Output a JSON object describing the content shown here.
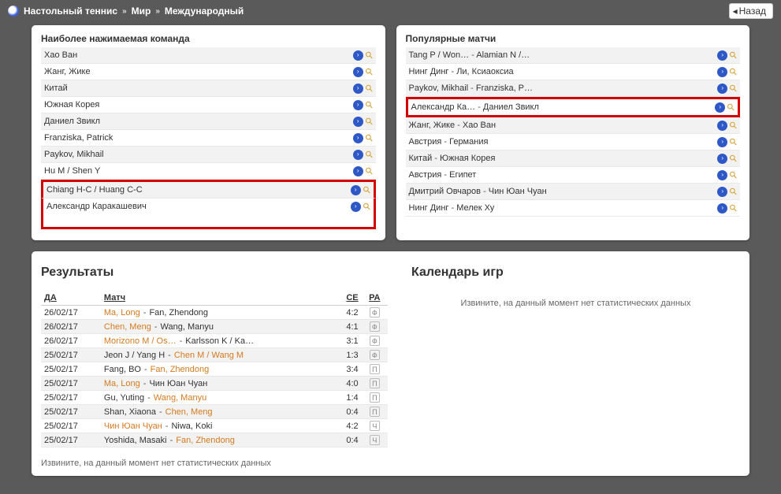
{
  "breadcrumb": {
    "sport": "Настольный теннис",
    "region": "Мир",
    "league": "Международный"
  },
  "back_label": "Назад",
  "teams_panel": {
    "title": "Наиболее нажимаемая команда",
    "items": [
      {
        "label": "Хао Ван"
      },
      {
        "label": "Жанг, Жике"
      },
      {
        "label": "Китай"
      },
      {
        "label": "Южная Корея"
      },
      {
        "label": "Даниел Звикл"
      },
      {
        "label": "Franziska, Patrick"
      },
      {
        "label": "Paykov, Mikhail"
      },
      {
        "label": "Hu M / Shen Y"
      },
      {
        "label": "Chiang H-C / Huang C-C"
      },
      {
        "label": "Александр Каракашевич"
      }
    ]
  },
  "matches_panel": {
    "title": "Популярные матчи",
    "items": [
      {
        "a": "Tang P / Won…",
        "b": "Alamian N /…"
      },
      {
        "a": "Нинг Динг",
        "b": "Ли, Ксиаоксиа"
      },
      {
        "a": "Paykov, Mikhail",
        "b": "Franziska, P…"
      },
      {
        "a": "Александр Ка…",
        "b": "Даниел Звикл"
      },
      {
        "a": "Жанг, Жике",
        "b": "Хао Ван"
      },
      {
        "a": "Австрия",
        "b": "Германия"
      },
      {
        "a": "Китай",
        "b": "Южная Корея"
      },
      {
        "a": "Австрия",
        "b": "Египет"
      },
      {
        "a": "Дмитрий Овчаров",
        "b": "Чин Юан Чуан"
      },
      {
        "a": "Нинг Динг",
        "b": "Мелек Ху"
      }
    ]
  },
  "results": {
    "title": "Результаты",
    "cols": {
      "date": "ДА",
      "match": "Матч",
      "set": "СЕ",
      "ra": "РА"
    },
    "rows": [
      {
        "date": "26/02/17",
        "a": "Ma, Long",
        "b": "Fan, Zhendong",
        "alink": true,
        "blink": false,
        "score": "4:2",
        "icon": "Ф"
      },
      {
        "date": "26/02/17",
        "a": "Chen, Meng",
        "b": "Wang, Manyu",
        "alink": true,
        "blink": false,
        "score": "4:1",
        "icon": "Ф"
      },
      {
        "date": "26/02/17",
        "a": "Morizono M / Os…",
        "b": "Karlsson K / Ka…",
        "alink": true,
        "blink": false,
        "score": "3:1",
        "icon": "Ф"
      },
      {
        "date": "25/02/17",
        "a": "Jeon J / Yang H",
        "b": "Chen M / Wang M",
        "alink": false,
        "blink": true,
        "score": "1:3",
        "icon": "Ф"
      },
      {
        "date": "25/02/17",
        "a": "Fang, BO",
        "b": "Fan, Zhendong",
        "alink": false,
        "blink": true,
        "score": "3:4",
        "icon": "П"
      },
      {
        "date": "25/02/17",
        "a": "Ma, Long",
        "b": "Чин Юан Чуан",
        "alink": true,
        "blink": false,
        "score": "4:0",
        "icon": "П"
      },
      {
        "date": "25/02/17",
        "a": "Gu, Yuting",
        "b": "Wang, Manyu",
        "alink": false,
        "blink": true,
        "score": "1:4",
        "icon": "П"
      },
      {
        "date": "25/02/17",
        "a": "Shan, Xiaona",
        "b": "Chen, Meng",
        "alink": false,
        "blink": true,
        "score": "0:4",
        "icon": "П"
      },
      {
        "date": "25/02/17",
        "a": "Чин Юан Чуан",
        "b": "Niwa, Koki",
        "alink": true,
        "blink": false,
        "score": "4:2",
        "icon": "Ч"
      },
      {
        "date": "25/02/17",
        "a": "Yoshida, Masaki",
        "b": "Fan, Zhendong",
        "alink": false,
        "blink": true,
        "score": "0:4",
        "icon": "Ч"
      }
    ],
    "nodata": "Извините, на данный момент нет статистических данных"
  },
  "calendar": {
    "title": "Календарь игр",
    "nodata": "Извините, на данный момент нет статистических данных"
  }
}
